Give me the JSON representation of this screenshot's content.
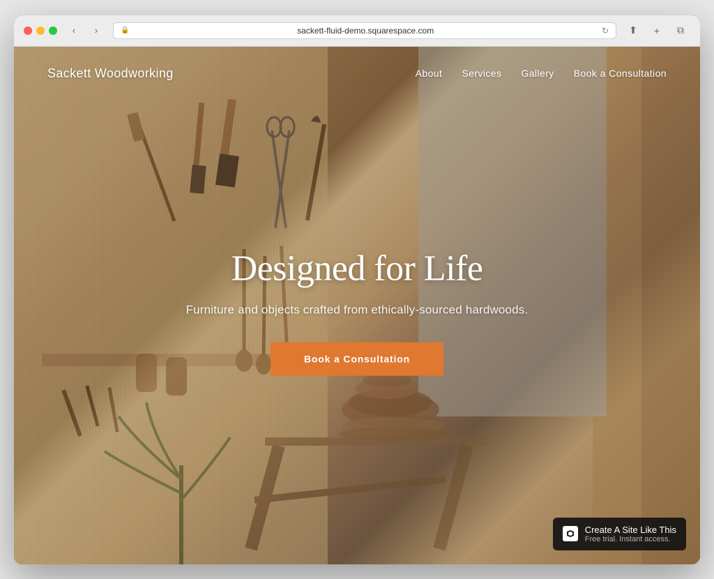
{
  "browser": {
    "url": "sackett-fluid-demo.squarespace.com",
    "nav": {
      "back": "‹",
      "forward": "›",
      "refresh": "↻"
    },
    "actions": {
      "share": "⬆",
      "new_tab": "+",
      "tabs": "⧉"
    }
  },
  "site": {
    "logo": "Sackett Woodworking",
    "nav": {
      "about": "About",
      "services": "Services",
      "gallery": "Gallery",
      "book": "Book a Consultation"
    },
    "hero": {
      "title": "Designed for Life",
      "subtitle": "Furniture and objects crafted from ethically-sourced hardwoods.",
      "cta": "Book a Consultation"
    }
  },
  "badge": {
    "title": "Create A Site Like This",
    "subtitle": "Free trial. Instant access.",
    "logo_text": "S"
  }
}
